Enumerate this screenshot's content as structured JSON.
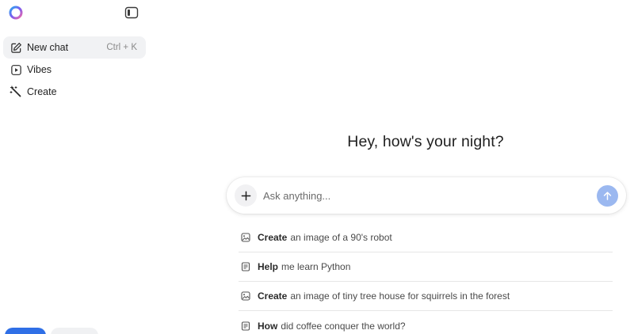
{
  "sidebar": {
    "logo_icon": "copilot-ring-logo",
    "collapse_icon": "sidebar-toggle-icon",
    "items": [
      {
        "label": "New chat",
        "shortcut": "Ctrl + K",
        "icon": "edit-icon",
        "active": true
      },
      {
        "label": "Vibes",
        "icon": "play-square-icon",
        "active": false
      },
      {
        "label": "Create",
        "icon": "magic-wand-icon",
        "active": false
      }
    ]
  },
  "main": {
    "greeting": "Hey, how's your night?",
    "composer": {
      "placeholder": "Ask anything...",
      "plus_icon": "plus-icon",
      "send_icon": "arrow-up-icon"
    },
    "suggestions": [
      {
        "bold": "Create",
        "rest": "an image of a 90's robot",
        "icon": "image-icon"
      },
      {
        "bold": "Help",
        "rest": "me learn Python",
        "icon": "book-icon"
      },
      {
        "bold": "Create",
        "rest": "an image of tiny tree house for squirrels in the forest",
        "icon": "image-icon"
      },
      {
        "bold": "How",
        "rest": "did coffee conquer the world?",
        "icon": "book-icon"
      }
    ]
  },
  "colors": {
    "accent": "#2f6fe6",
    "send_button": "#9bb8f0",
    "active_nav_bg": "#f1f2f4"
  }
}
